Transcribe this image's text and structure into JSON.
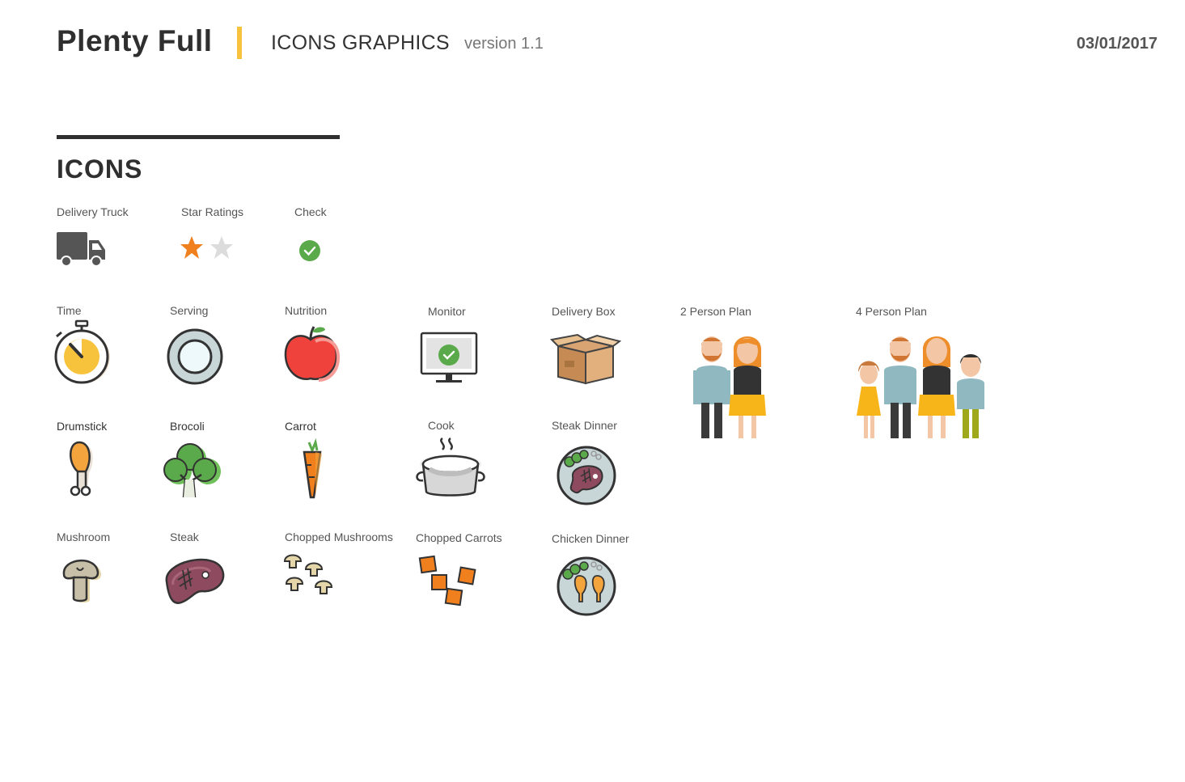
{
  "header": {
    "brand": "Plenty Full",
    "subtitle": "ICONS GRAPHICS",
    "version": "version 1.1",
    "date": "03/01/2017"
  },
  "section": {
    "title": "ICONS"
  },
  "icons": {
    "delivery_truck": "Delivery Truck",
    "star_ratings": "Star Ratings",
    "check": "Check",
    "time": "Time",
    "serving": "Serving",
    "nutrition": "Nutrition",
    "monitor": "Monitor",
    "delivery_box": "Delivery Box",
    "two_person_plan": "2 Person Plan",
    "four_person_plan": "4 Person Plan",
    "drumstick": "Drumstick",
    "brocoli": "Brocoli",
    "carrot": "Carrot",
    "cook": "Cook",
    "steak_dinner": "Steak Dinner",
    "mushroom": "Mushroom",
    "steak": "Steak",
    "chopped_mushrooms": "Chopped Mushrooms",
    "chopped_carrots": "Chopped Carrots",
    "chicken_dinner": "Chicken Dinner"
  },
  "colors": {
    "accent_yellow": "#f7c23c",
    "orange": "#f07f1d",
    "green": "#5aa94a",
    "red": "#f0423c",
    "steak": "#8e4a5e",
    "shirt_blue": "#8fb8c0",
    "dark": "#333333"
  }
}
